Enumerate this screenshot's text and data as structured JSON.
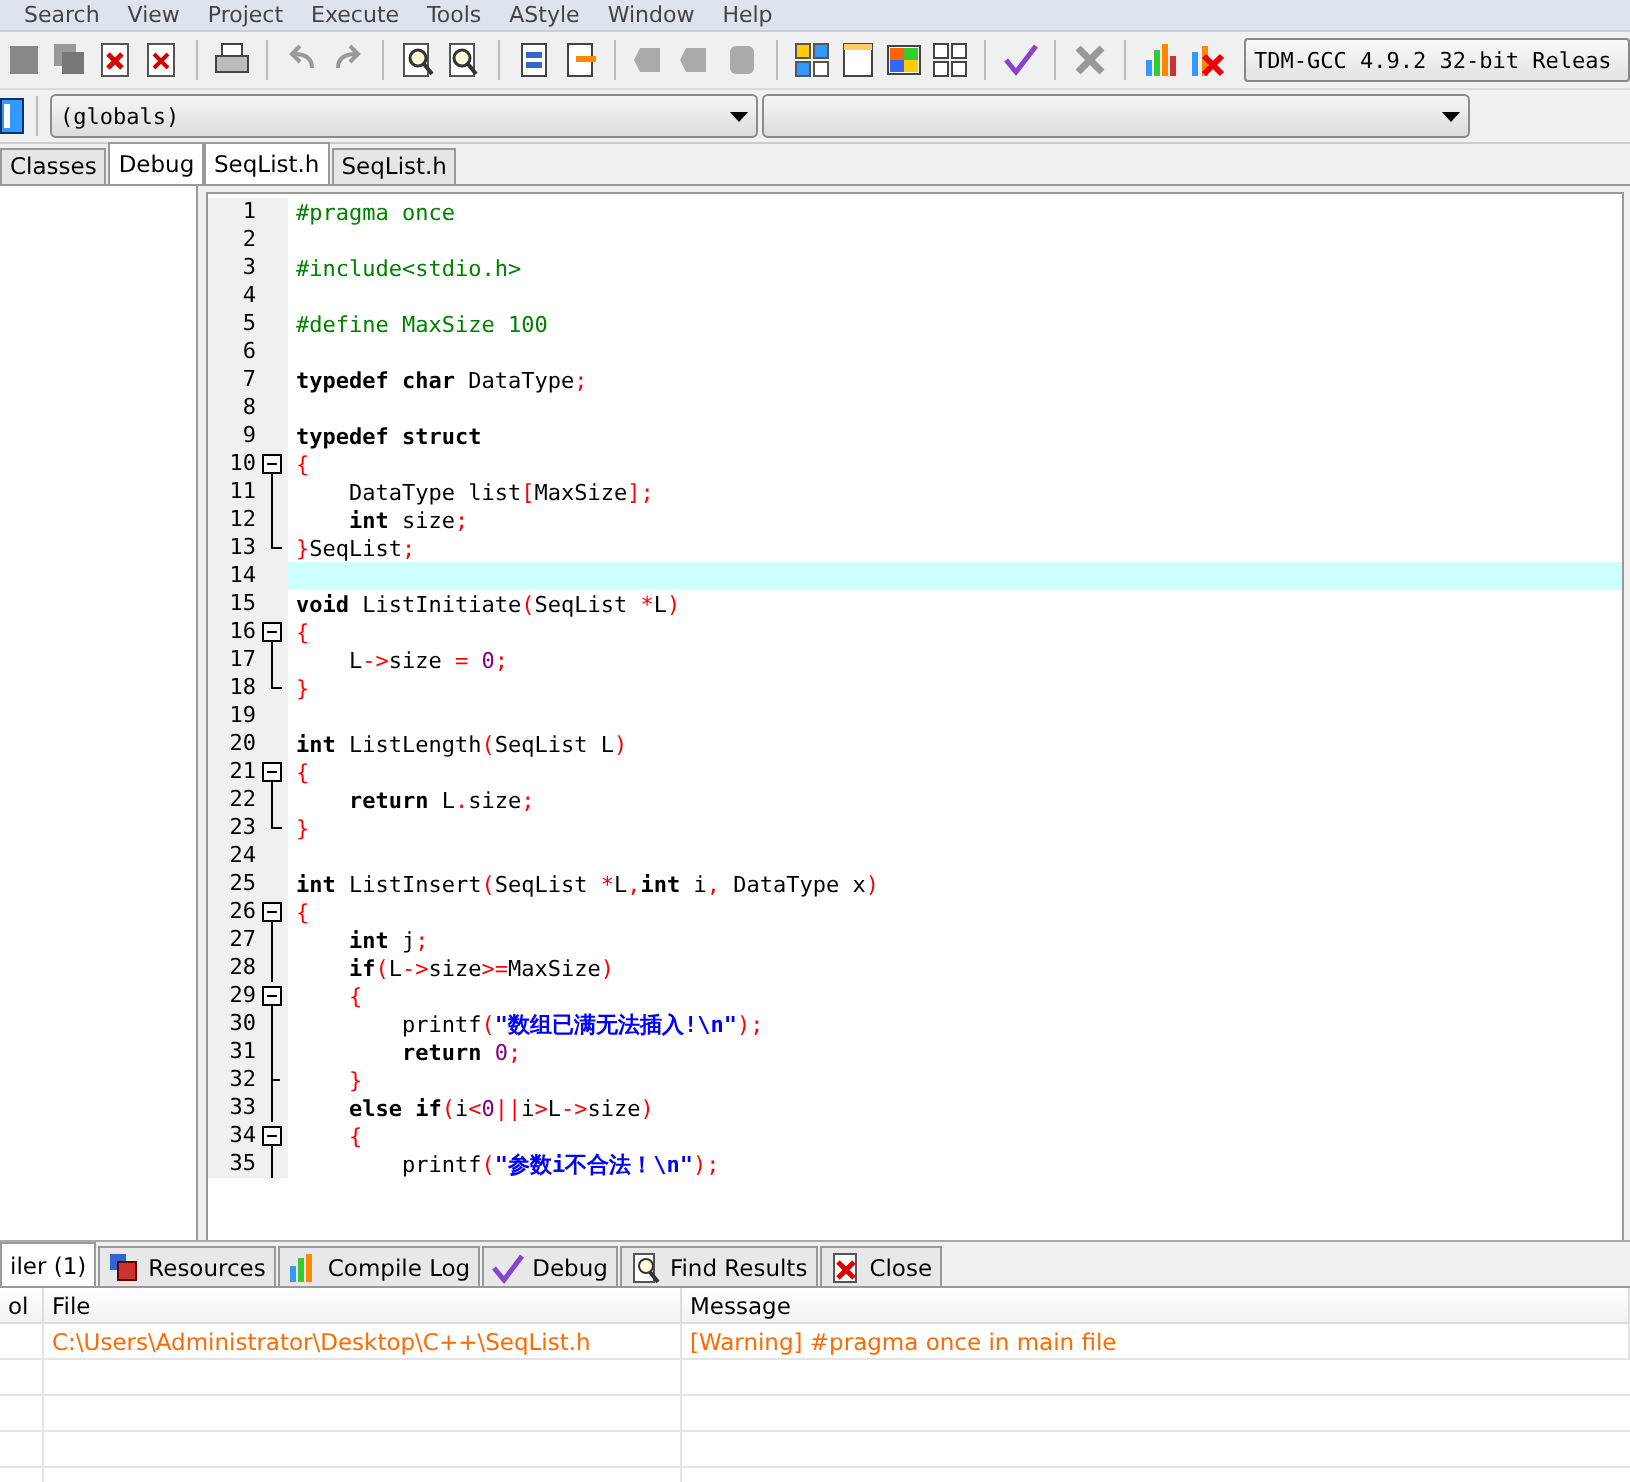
{
  "menu": [
    "Search",
    "View",
    "Project",
    "Execute",
    "Tools",
    "AStyle",
    "Window",
    "Help"
  ],
  "compiler": "TDM-GCC 4.9.2 32-bit Releas",
  "scope_select": "(globals)",
  "side_tabs": [
    {
      "label": "Classes",
      "selected": false
    },
    {
      "label": "Debug",
      "selected": true
    }
  ],
  "editor_tabs": [
    {
      "label": "SeqList.h",
      "selected": true
    },
    {
      "label": "SeqList.h",
      "selected": false
    }
  ],
  "lines": [
    {
      "n": "1",
      "current": false,
      "text": "#pragma once"
    },
    {
      "n": "2",
      "current": false
    },
    {
      "n": "3",
      "current": false,
      "text": "#include<stdio.h>"
    },
    {
      "n": "4",
      "current": false
    },
    {
      "n": "5",
      "current": false,
      "text": "#define MaxSize 100"
    },
    {
      "n": "6",
      "current": false
    },
    {
      "n": "7",
      "current": false,
      "text": "**typedef** **char** DataType;"
    },
    {
      "n": "8",
      "current": false
    },
    {
      "n": "9",
      "current": false,
      "text": "**typedef** **struct**"
    },
    {
      "n": "10",
      "current": false,
      "kind": "start",
      "text": "{"
    },
    {
      "n": "11",
      "current": false,
      "kind": "body",
      "text": "    DataType list[MaxSize];"
    },
    {
      "n": "12",
      "current": false,
      "kind": "body",
      "text": "    **int** size;"
    },
    {
      "n": "13",
      "current": false,
      "kind": "end",
      "text": "}SeqList;"
    },
    {
      "n": "14",
      "current": true
    },
    {
      "n": "15",
      "current": false,
      "text": "**void** ListInitiate(SeqList *L)"
    },
    {
      "n": "16",
      "current": false,
      "kind": "start",
      "text": "{"
    },
    {
      "n": "17",
      "current": false,
      "kind": "body",
      "text": "    L->size = 0;"
    },
    {
      "n": "18",
      "current": false,
      "kind": "end",
      "text": "}"
    },
    {
      "n": "19",
      "current": false
    },
    {
      "n": "20",
      "current": false,
      "text": "**int** ListLength(SeqList L)"
    },
    {
      "n": "21",
      "current": false,
      "kind": "start",
      "text": "{"
    },
    {
      "n": "22",
      "current": false,
      "kind": "body",
      "text": "    **return** L.size;"
    },
    {
      "n": "23",
      "current": false,
      "kind": "end",
      "text": "}"
    },
    {
      "n": "24",
      "current": false
    },
    {
      "n": "25",
      "current": false,
      "text": "**int** ListInsert(SeqList *L,**int** i, DataType x)"
    },
    {
      "n": "26",
      "current": false,
      "kind": "start",
      "text": "{"
    },
    {
      "n": "27",
      "current": false,
      "kind": "body",
      "text": "    **int** j;"
    },
    {
      "n": "28",
      "current": false,
      "kind": "body",
      "text": "    **if**(L->size>=MaxSize)"
    },
    {
      "n": "29",
      "current": false,
      "kind": "start",
      "text": "    {"
    },
    {
      "n": "30",
      "current": false,
      "kind": "body",
      "text": "        printf(\"数组已满无法插入!\\n\");"
    },
    {
      "n": "31",
      "current": false,
      "kind": "body",
      "text": "        **return** 0;"
    },
    {
      "n": "32",
      "current": false,
      "kind": "branch",
      "text": "    }"
    },
    {
      "n": "33",
      "current": false,
      "kind": "body",
      "text": "    **else** **if**(i<0||i>L->size)"
    },
    {
      "n": "34",
      "current": false,
      "kind": "start",
      "text": "    {"
    },
    {
      "n": "35",
      "current": false,
      "kind": "body",
      "text": "        printf(\"参数i不合法！\\n\");"
    }
  ],
  "bottom_tabs": [
    {
      "label": "iler (1)",
      "selected": true
    },
    {
      "label": "Resources",
      "selected": false
    },
    {
      "label": "Compile Log",
      "selected": false
    },
    {
      "label": "Debug",
      "selected": false
    },
    {
      "label": "Find Results",
      "selected": false
    },
    {
      "label": "Close",
      "selected": false
    }
  ],
  "messages": {
    "columns": [
      "ol",
      "File",
      "Message"
    ],
    "rows": [
      {
        "file": "C:\\Users\\Administrator\\Desktop\\C++\\SeqList.h",
        "message": "[Warning] #pragma once in main file"
      }
    ]
  }
}
